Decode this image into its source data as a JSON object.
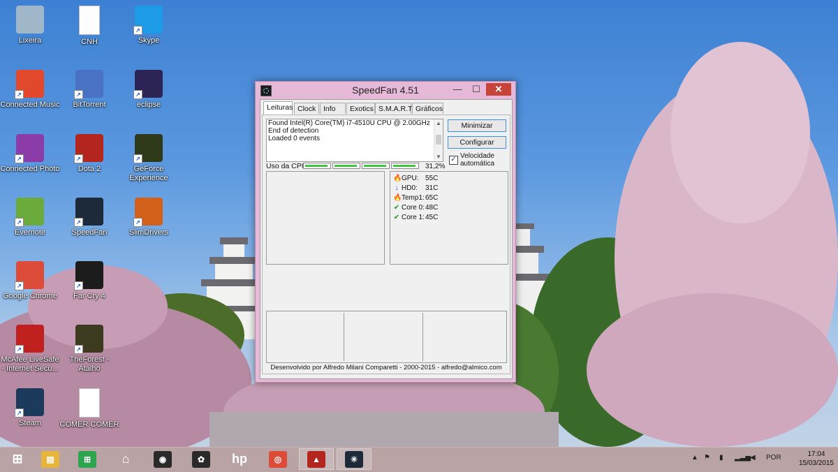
{
  "desktop_icons": [
    {
      "label": "Lixeira",
      "icon": "recycle-bin-icon",
      "color": "#9fb7c9"
    },
    {
      "label": "CNH",
      "icon": "document-icon",
      "color": "#ffffff"
    },
    {
      "label": "Skype",
      "icon": "skype-icon",
      "color": "#1e9be6"
    },
    {
      "label": "Connected Music",
      "icon": "connected-music-icon",
      "color": "#e2492c"
    },
    {
      "label": "BitTorrent",
      "icon": "bittorrent-icon",
      "color": "#4a72c4"
    },
    {
      "label": "eclipse",
      "icon": "eclipse-icon",
      "color": "#2c2455"
    },
    {
      "label": "Connected Photo",
      "icon": "connected-photo-icon",
      "color": "#8c3ca8"
    },
    {
      "label": "Dota 2",
      "icon": "dota2-icon",
      "color": "#b3261e"
    },
    {
      "label": "GeForce Experience",
      "icon": "geforce-icon",
      "color": "#2f3a1a"
    },
    {
      "label": "Evernote",
      "icon": "evernote-icon",
      "color": "#6aab3c"
    },
    {
      "label": "SpeedFan",
      "icon": "speedfan-icon",
      "color": "#1d2a3a"
    },
    {
      "label": "SlimDrivers",
      "icon": "slimdrivers-icon",
      "color": "#d3601a"
    },
    {
      "label": "Google Chrome",
      "icon": "chrome-icon",
      "color": "#dd4b39"
    },
    {
      "label": "Far Cry 4",
      "icon": "farcry4-icon",
      "color": "#1c1c1c"
    },
    {
      "label": "McAfee LiveSafe - Internet Secu...",
      "icon": "mcafee-icon",
      "color": "#c0201e"
    },
    {
      "label": "TheForest - Atalho",
      "icon": "theforest-icon",
      "color": "#3d3b1f"
    },
    {
      "label": "Steam",
      "icon": "steam-icon",
      "color": "#1b3a5c"
    },
    {
      "label": "COMER COMER",
      "icon": "document-icon",
      "color": "#ffffff"
    }
  ],
  "window": {
    "title": "SpeedFan 4.51",
    "minimize_glyph": "—",
    "maximize_glyph": "☐",
    "close_glyph": "✕",
    "tabs": [
      "Leituras",
      "Clock",
      "Info",
      "Exotics",
      "S.M.A.R.T",
      "Gráficos"
    ],
    "log_lines": [
      "Found Intel(R) Core(TM) i7-4510U CPU @ 2.00GHz",
      "End of detection",
      "Loaded 0 events"
    ],
    "minimize_button": "Minimizar",
    "configure_button": "Configurar",
    "auto_speed_label": "Velocidade automática",
    "auto_speed_checked": true,
    "cpu_usage_label": "Uso da CPU",
    "cpu_usage_value": "31,2%",
    "cpu_core_levels": [
      0.95,
      0.95,
      0.95,
      0.95
    ],
    "temperatures": [
      {
        "name": "GPU:",
        "value": "55C",
        "status": "hot"
      },
      {
        "name": "HD0:",
        "value": "31C",
        "status": "cold"
      },
      {
        "name": "Temp1:",
        "value": "65C",
        "status": "hot"
      },
      {
        "name": "Core 0:",
        "value": "48C",
        "status": "ok"
      },
      {
        "name": "Core 1:",
        "value": "45C",
        "status": "ok"
      }
    ],
    "footer": "Desenvolvido por Alfredo Milani Comparetti - 2000-2015 - alfredo@almico.com"
  },
  "taskbar": {
    "items": [
      {
        "name": "start-button",
        "icon": "windows-logo-icon",
        "color": "#ffffff"
      },
      {
        "name": "file-explorer",
        "icon": "folder-icon",
        "color": "#e8b53c"
      },
      {
        "name": "store",
        "icon": "store-icon",
        "color": "#2fa44f"
      },
      {
        "name": "home",
        "icon": "home-icon",
        "color": "#ffffff"
      },
      {
        "name": "webcam-app",
        "icon": "webcam-icon",
        "color": "#2a2a2a"
      },
      {
        "name": "photo-app",
        "icon": "photo-app-icon",
        "color": "#2a2a2a"
      },
      {
        "name": "hp-app",
        "icon": "hp-icon",
        "color": "#ffffff"
      },
      {
        "name": "chrome",
        "icon": "chrome-icon",
        "color": "#dd4b39"
      },
      {
        "name": "dota2",
        "icon": "dota2-icon",
        "color": "#b3261e"
      },
      {
        "name": "speedfan",
        "icon": "speedfan-icon",
        "color": "#1d2a3a"
      }
    ],
    "language": "POR",
    "time": "17:04",
    "date": "15/03/2015"
  }
}
